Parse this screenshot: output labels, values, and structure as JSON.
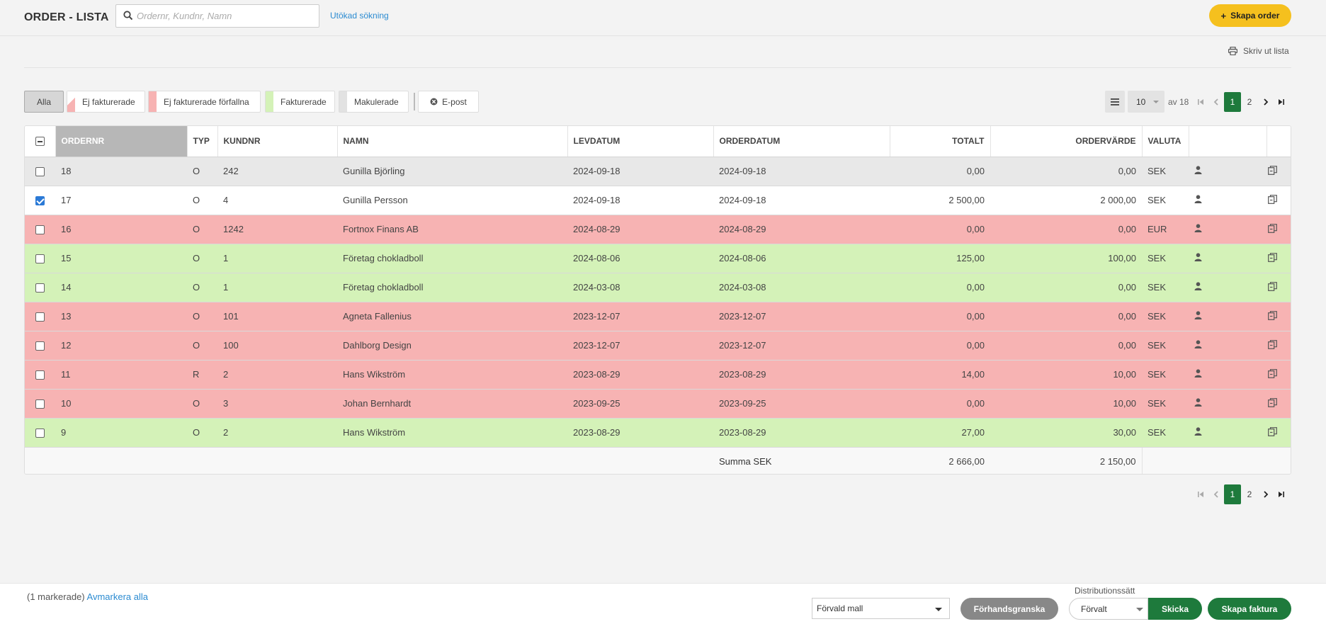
{
  "header": {
    "title": "ORDER - LISTA",
    "search_placeholder": "Ordernr, Kundnr, Namn",
    "search_value": "",
    "advanced_search": "Utökad sökning",
    "create_order": "Skapa order"
  },
  "toolbar": {
    "print_list": "Skriv ut lista"
  },
  "filters": [
    {
      "label": "Alla"
    },
    {
      "label": "Ej fakturerade"
    },
    {
      "label": "Ej fakturerade förfallna"
    },
    {
      "label": "Fakturerade"
    },
    {
      "label": "Makulerade"
    },
    {
      "label": "E-post"
    }
  ],
  "colors": {
    "accent_yellow": "#f5c01e",
    "brand_green": "#1e7a3c",
    "row_red": "#f7b3b3",
    "row_green": "#d4f2b8",
    "row_gray": "#e8e8e8"
  },
  "pagination": {
    "per_page": "10",
    "of_label": "av 18",
    "pages": [
      "1",
      "2"
    ],
    "current": "1"
  },
  "table": {
    "columns": [
      "ORDERNR",
      "TYP",
      "KUNDNR",
      "NAMN",
      "LEVDATUM",
      "ORDERDATUM",
      "TOTALT",
      "ORDERVÄRDE",
      "VALUTA"
    ],
    "rows": [
      {
        "ordernr": "18",
        "typ": "O",
        "kundnr": "242",
        "namn": "Gunilla Björling",
        "levdatum": "2024-09-18",
        "orderdatum": "2024-09-18",
        "totalt": "0,00",
        "ordervarde": "0,00",
        "valuta": "SEK",
        "status": "gray",
        "checked": false
      },
      {
        "ordernr": "17",
        "typ": "O",
        "kundnr": "4",
        "namn": "Gunilla Persson",
        "levdatum": "2024-09-18",
        "orderdatum": "2024-09-18",
        "totalt": "2 500,00",
        "ordervarde": "2 000,00",
        "valuta": "SEK",
        "status": "white",
        "checked": true
      },
      {
        "ordernr": "16",
        "typ": "O",
        "kundnr": "1242",
        "namn": "Fortnox Finans AB",
        "levdatum": "2024-08-29",
        "orderdatum": "2024-08-29",
        "totalt": "0,00",
        "ordervarde": "0,00",
        "valuta": "EUR",
        "status": "red",
        "checked": false
      },
      {
        "ordernr": "15",
        "typ": "O",
        "kundnr": "1",
        "namn": "Företag chokladboll",
        "levdatum": "2024-08-06",
        "orderdatum": "2024-08-06",
        "totalt": "125,00",
        "ordervarde": "100,00",
        "valuta": "SEK",
        "status": "green",
        "checked": false
      },
      {
        "ordernr": "14",
        "typ": "O",
        "kundnr": "1",
        "namn": "Företag chokladboll",
        "levdatum": "2024-03-08",
        "orderdatum": "2024-03-08",
        "totalt": "0,00",
        "ordervarde": "0,00",
        "valuta": "SEK",
        "status": "green",
        "checked": false
      },
      {
        "ordernr": "13",
        "typ": "O",
        "kundnr": "101",
        "namn": "Agneta Fallenius",
        "levdatum": "2023-12-07",
        "orderdatum": "2023-12-07",
        "totalt": "0,00",
        "ordervarde": "0,00",
        "valuta": "SEK",
        "status": "red",
        "checked": false
      },
      {
        "ordernr": "12",
        "typ": "O",
        "kundnr": "100",
        "namn": "Dahlborg Design",
        "levdatum": "2023-12-07",
        "orderdatum": "2023-12-07",
        "totalt": "0,00",
        "ordervarde": "0,00",
        "valuta": "SEK",
        "status": "red",
        "checked": false
      },
      {
        "ordernr": "11",
        "typ": "R",
        "kundnr": "2",
        "namn": "Hans Wikström",
        "levdatum": "2023-08-29",
        "orderdatum": "2023-08-29",
        "totalt": "14,00",
        "ordervarde": "10,00",
        "valuta": "SEK",
        "status": "red",
        "checked": false
      },
      {
        "ordernr": "10",
        "typ": "O",
        "kundnr": "3",
        "namn": "Johan Bernhardt",
        "levdatum": "2023-09-25",
        "orderdatum": "2023-09-25",
        "totalt": "0,00",
        "ordervarde": "10,00",
        "valuta": "SEK",
        "status": "red",
        "checked": false
      },
      {
        "ordernr": "9",
        "typ": "O",
        "kundnr": "2",
        "namn": "Hans Wikström",
        "levdatum": "2023-08-29",
        "orderdatum": "2023-08-29",
        "totalt": "27,00",
        "ordervarde": "30,00",
        "valuta": "SEK",
        "status": "green",
        "checked": false
      }
    ],
    "summary": {
      "label": "Summa SEK",
      "totalt": "2 666,00",
      "ordervarde": "2 150,00"
    }
  },
  "footer": {
    "selected_count": "(1 markerade)",
    "deselect_all": "Avmarkera alla",
    "template_select": "Förvald mall",
    "preview": "Förhandsgranska",
    "distribution_label": "Distributionssätt",
    "distribution_value": "Förvalt",
    "send": "Skicka",
    "create_invoice": "Skapa faktura"
  }
}
